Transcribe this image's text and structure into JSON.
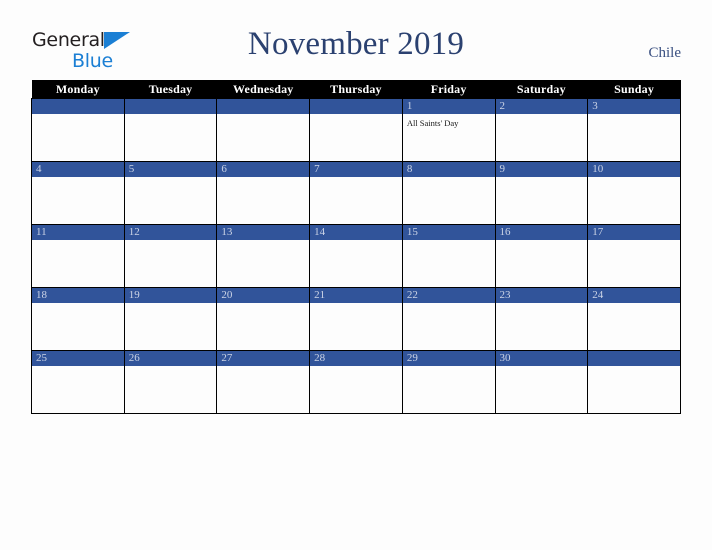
{
  "brand": {
    "word_one": "General",
    "word_two": "Blue",
    "triangle_icon": "blue-triangle-icon",
    "color_dark": "#231f20",
    "color_blue": "#1b7fd4"
  },
  "header": {
    "title": "November 2019",
    "country": "Chile",
    "title_color": "#2b4170"
  },
  "calendar": {
    "weekday_headers": [
      "Monday",
      "Tuesday",
      "Wednesday",
      "Thursday",
      "Friday",
      "Saturday",
      "Sunday"
    ],
    "header_bg": "#000000",
    "daybar_bg": "#31549a",
    "daynum_color": "#ccd4e6",
    "border_color": "#000000",
    "weeks": [
      [
        {
          "day": "",
          "events": []
        },
        {
          "day": "",
          "events": []
        },
        {
          "day": "",
          "events": []
        },
        {
          "day": "",
          "events": []
        },
        {
          "day": "1",
          "events": [
            "All Saints' Day"
          ]
        },
        {
          "day": "2",
          "events": []
        },
        {
          "day": "3",
          "events": []
        }
      ],
      [
        {
          "day": "4",
          "events": []
        },
        {
          "day": "5",
          "events": []
        },
        {
          "day": "6",
          "events": []
        },
        {
          "day": "7",
          "events": []
        },
        {
          "day": "8",
          "events": []
        },
        {
          "day": "9",
          "events": []
        },
        {
          "day": "10",
          "events": []
        }
      ],
      [
        {
          "day": "11",
          "events": []
        },
        {
          "day": "12",
          "events": []
        },
        {
          "day": "13",
          "events": []
        },
        {
          "day": "14",
          "events": []
        },
        {
          "day": "15",
          "events": []
        },
        {
          "day": "16",
          "events": []
        },
        {
          "day": "17",
          "events": []
        }
      ],
      [
        {
          "day": "18",
          "events": []
        },
        {
          "day": "19",
          "events": []
        },
        {
          "day": "20",
          "events": []
        },
        {
          "day": "21",
          "events": []
        },
        {
          "day": "22",
          "events": []
        },
        {
          "day": "23",
          "events": []
        },
        {
          "day": "24",
          "events": []
        }
      ],
      [
        {
          "day": "25",
          "events": []
        },
        {
          "day": "26",
          "events": []
        },
        {
          "day": "27",
          "events": []
        },
        {
          "day": "28",
          "events": []
        },
        {
          "day": "29",
          "events": []
        },
        {
          "day": "30",
          "events": []
        },
        {
          "day": "",
          "events": []
        }
      ]
    ]
  }
}
